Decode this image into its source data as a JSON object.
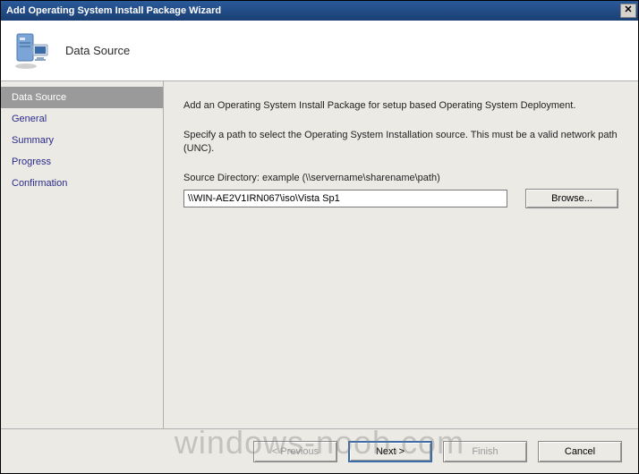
{
  "window": {
    "title": "Add Operating System Install Package Wizard",
    "close_glyph": "✕"
  },
  "header": {
    "title": "Data Source"
  },
  "sidebar": {
    "items": [
      {
        "label": "Data Source",
        "active": true
      },
      {
        "label": "General",
        "active": false
      },
      {
        "label": "Summary",
        "active": false
      },
      {
        "label": "Progress",
        "active": false
      },
      {
        "label": "Confirmation",
        "active": false
      }
    ]
  },
  "content": {
    "intro": "Add an Operating System Install Package for setup based Operating System Deployment.",
    "instruction": "Specify a path to select the Operating System Installation source. This must be a valid network path (UNC).",
    "source_label": "Source Directory: example (\\\\servername\\sharename\\path)",
    "source_value": "\\\\WIN-AE2V1IRN067\\iso\\Vista Sp1",
    "browse_label": "Browse..."
  },
  "footer": {
    "previous": "< Previous",
    "next": "Next >",
    "finish": "Finish",
    "cancel": "Cancel"
  },
  "watermark": "windows-noob.com"
}
